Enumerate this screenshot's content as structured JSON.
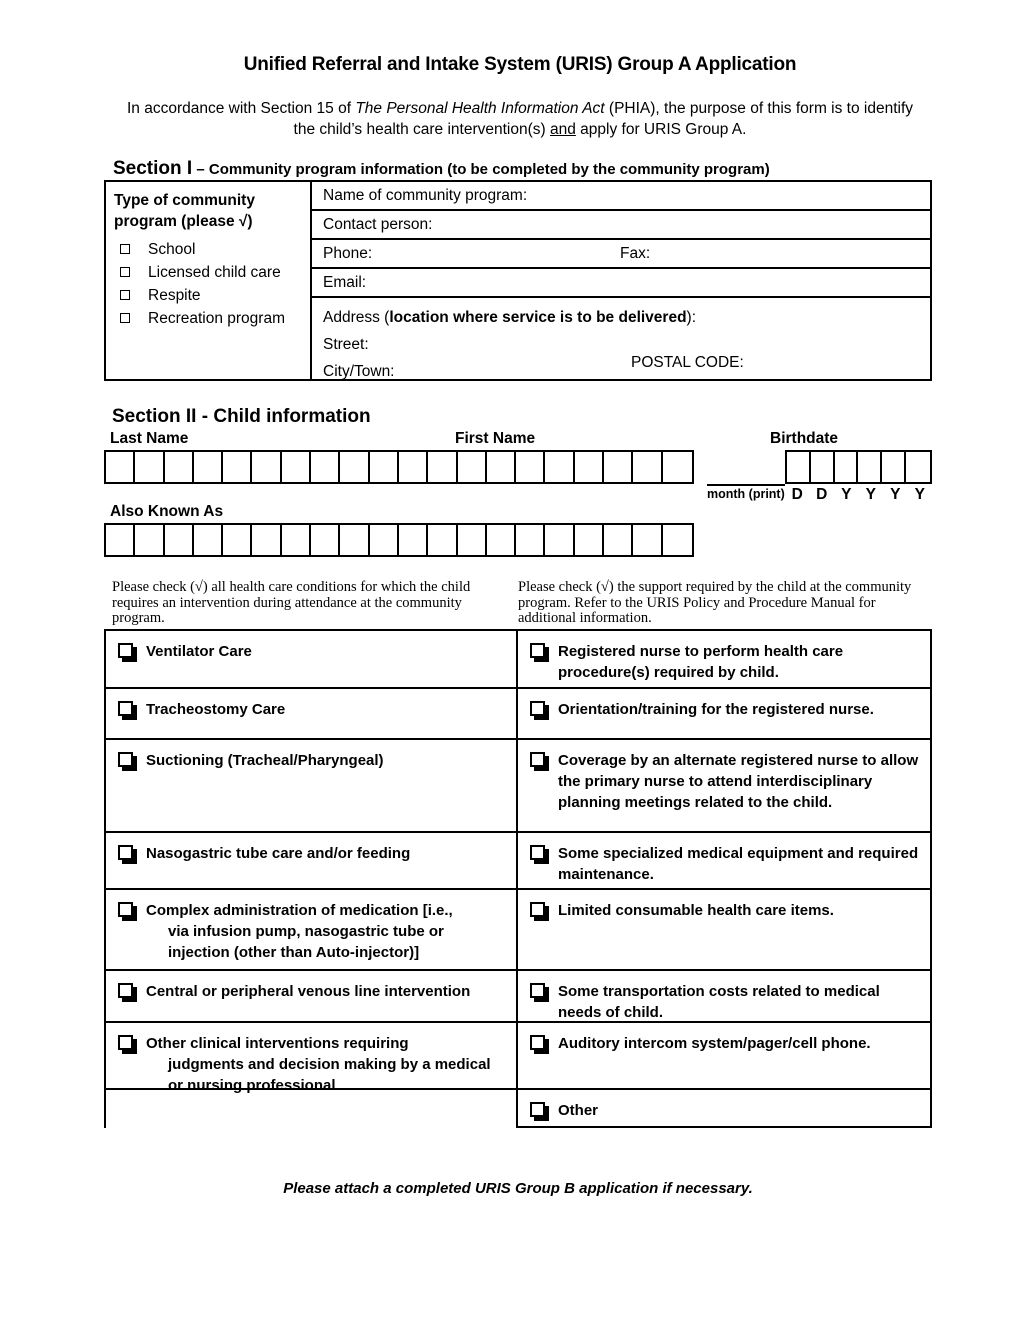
{
  "document": {
    "title": "Unified Referral and Intake System (URIS) Group A Application",
    "intro_before_italic": "In accordance with Section 15 of ",
    "intro_italic": "The Personal Health Information Act",
    "intro_after_italic": " (PHIA), the purpose of this form is to identify the child’s health care intervention(s) ",
    "intro_underlined": "and",
    "intro_end": " apply for URIS Group A.",
    "footer_note": "Please attach a completed URIS Group B application if necessary."
  },
  "section1": {
    "heading_label": "Section I",
    "heading_rest": " – Community program information (to be completed by the community program)",
    "left_title": "Type of community program (please √)",
    "program_types": [
      "School",
      "Licensed child care",
      "Respite",
      "Recreation program"
    ],
    "fields": {
      "name": "Name of community program:",
      "contact": "Contact person:",
      "phone": "Phone:",
      "fax": "Fax:",
      "email": "Email:",
      "address_label": "Address (",
      "address_bold": "location where service is to be delivered",
      "address_suffix": "):",
      "street": "Street:",
      "city": "City/Town:",
      "postal": "POSTAL CODE:"
    }
  },
  "section2": {
    "heading": "Section II - Child information",
    "labels": {
      "last_name": "Last Name",
      "first_name": "First Name",
      "birthdate": "Birthdate",
      "also_known_as": "Also Known As"
    },
    "name_comb_cells": 20,
    "aka_comb_cells": 20,
    "birth_comb_cells": 6,
    "birth_legend": {
      "month": "month (print)",
      "day_year": [
        "D",
        "D",
        "Y",
        "Y",
        "Y",
        "Y"
      ]
    }
  },
  "instructions": {
    "left": "Please check (√) all health care conditions for which the child requires an intervention during attendance at the community program.",
    "right": "Please check (√) the support required by the child at the community program.  Refer to the URIS Policy and Procedure Manual for additional information."
  },
  "checklist": {
    "rows": [
      {
        "left": {
          "text": "Ventilator Care",
          "checkbox": true
        },
        "right": {
          "text": "Registered nurse to perform health care procedure(s) required by child.",
          "checkbox": true
        }
      },
      {
        "left": {
          "text": "Tracheostomy Care",
          "checkbox": true
        },
        "right": {
          "text": "Orientation/training for the registered nurse.",
          "checkbox": true
        }
      },
      {
        "left": {
          "text": "Suctioning (Tracheal/Pharyngeal)",
          "checkbox": true
        },
        "right": {
          "text": "Coverage by an alternate registered nurse to allow the primary nurse to attend interdisciplinary planning meetings related to the child.",
          "checkbox": true
        }
      },
      {
        "left": {
          "text": "Nasogastric tube care and/or feeding",
          "checkbox": true
        },
        "right": {
          "text": "Some specialized medical equipment and required maintenance.",
          "checkbox": true
        }
      },
      {
        "left": {
          "text": "Complex administration of medication [i.e.,",
          "text_indented": "via infusion pump, nasogastric tube or injection (other than Auto-injector)]",
          "checkbox": true
        },
        "right": {
          "text": "Limited consumable health care items.",
          "checkbox": true
        }
      },
      {
        "left": {
          "text": "Central or peripheral venous line intervention",
          "checkbox": true
        },
        "right": {
          "text": "Some transportation costs related to medical needs of child.",
          "checkbox": true
        }
      },
      {
        "left": {
          "text": "Other clinical interventions requiring",
          "text_indented": "judgments and decision making by a medical or nursing professional",
          "checkbox": true
        },
        "right": {
          "text": "Auditory intercom system/pager/cell phone.",
          "checkbox": true
        }
      },
      {
        "left": {
          "text": "",
          "checkbox": false
        },
        "right": {
          "text": "Other",
          "checkbox": true
        }
      }
    ]
  }
}
